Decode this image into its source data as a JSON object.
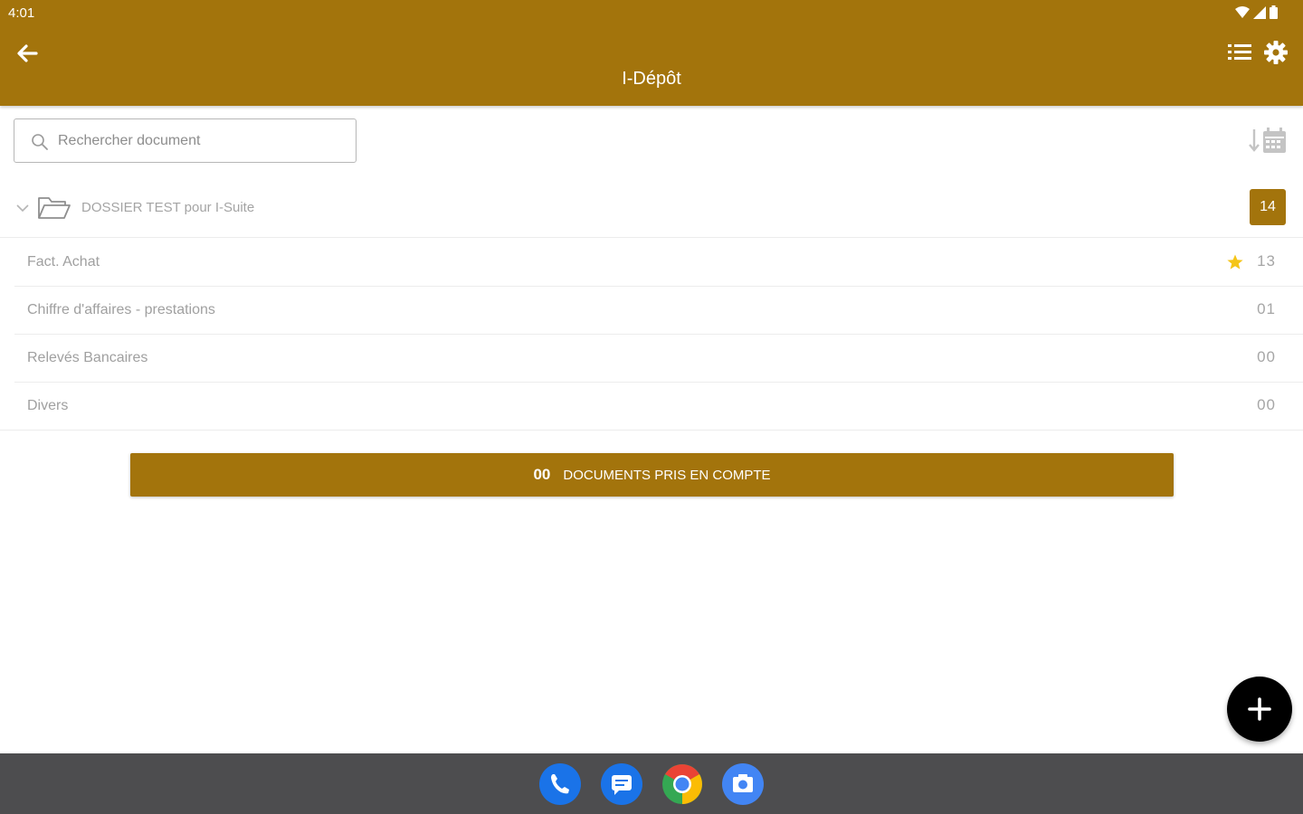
{
  "status_bar": {
    "time": "4:01"
  },
  "app_bar": {
    "title": "I-Dépôt"
  },
  "search": {
    "placeholder": "Rechercher document"
  },
  "folder": {
    "name": "DOSSIER TEST pour I-Suite",
    "count": "14"
  },
  "categories": [
    {
      "label": "Fact. Achat",
      "count": "13",
      "starred": true
    },
    {
      "label": "Chiffre d'affaires - prestations",
      "count": "01",
      "starred": false
    },
    {
      "label": "Relevés Bancaires",
      "count": "00",
      "starred": false
    },
    {
      "label": "Divers",
      "count": "00",
      "starred": false
    }
  ],
  "summary": {
    "count": "00",
    "label": "DOCUMENTS PRIS EN COMPTE"
  },
  "colors": {
    "primary": "#a3740c",
    "star": "#f5c518",
    "fab": "#000000",
    "navbar": "#4d4d4f"
  },
  "icons": [
    "back-arrow-icon",
    "list-view-icon",
    "gear-icon",
    "search-icon",
    "sort-by-date-icon",
    "chevron-down-icon",
    "folder-open-icon",
    "star-icon",
    "plus-icon",
    "phone-icon",
    "messages-icon",
    "chrome-icon",
    "camera-icon"
  ]
}
